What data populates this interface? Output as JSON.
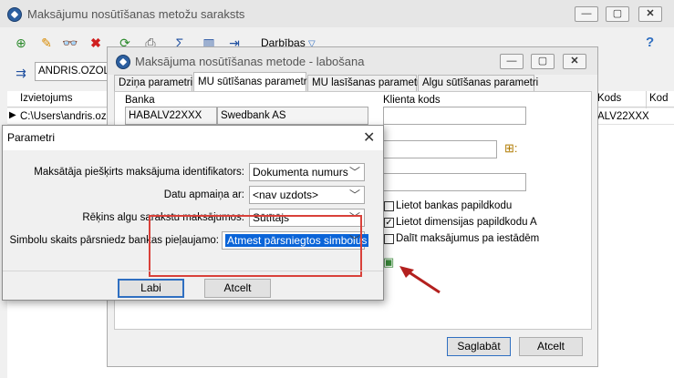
{
  "main_window": {
    "title": "Maksājumu nosūtīšanas metožu saraksts",
    "toolbar": {
      "actions_label": "Darbības",
      "help": "?"
    },
    "filter_value": "ANDRIS.OZOLS",
    "grid": {
      "col_location": "Izvietojums",
      "col_code": "Kods",
      "col_code2": "Kod",
      "row_location": "C:\\Users\\andris.ozo",
      "row_code": "ALV22XXX"
    }
  },
  "edit_window": {
    "title": "Maksājuma nosūtīšanas metode - labošana",
    "tabs": [
      "Dziņa parametri",
      "MU sūtīšanas parametri",
      "MU lasīšanas parametri",
      "Algu sūtīšanas parametri"
    ],
    "active_tab_index": 1,
    "bank_label": "Banka",
    "bank_code": "HABALV22XXX",
    "bank_name": "Swedbank AS",
    "client_code_label": "Klienta kods",
    "checkboxes": [
      {
        "label": "Lietot bankas papildkodu",
        "checked": false
      },
      {
        "label": "Lietot dimensijas papildkodu A",
        "checked": true
      },
      {
        "label": "Dalīt maksājumus pa iestādēm",
        "checked": false
      }
    ],
    "save_label": "Saglabāt",
    "cancel_label": "Atcelt"
  },
  "dialog": {
    "title": "Parametri",
    "rows": [
      {
        "label": "Maksātāja piešķirts maksājuma identifikators:",
        "value": "Dokumenta numurs"
      },
      {
        "label": "Datu apmaiņa ar:",
        "value": "<nav uzdots>"
      },
      {
        "label": "Rēķins algu sarakstu maksājumos:",
        "value": "Sūtītājs"
      },
      {
        "label": "Simbolu skaits pārsniedz bankas pieļaujamo:",
        "value": "Atmest pārsniegtos simbolus"
      }
    ],
    "ok_label": "Labi",
    "cancel_label": "Atcelt"
  },
  "colors": {
    "highlight_box": "#d9413a",
    "arrow": "#b3201e",
    "selection": "#0a64d8"
  }
}
